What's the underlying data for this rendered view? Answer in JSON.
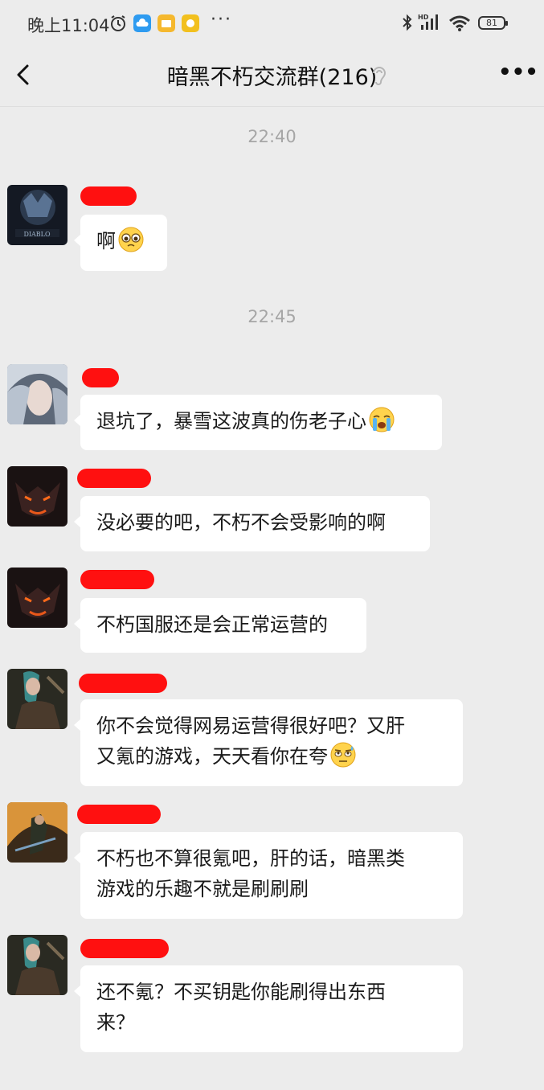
{
  "status_bar": {
    "time": "晚上11:04",
    "battery": "81",
    "more_icons": "···"
  },
  "header": {
    "back_icon": "chevron-left-icon",
    "title": "暗黑不朽交流群(216)",
    "more_label": "•••",
    "mute_icon": "ear-off-icon"
  },
  "chat": {
    "timestamps": [
      "22:40",
      "22:45"
    ],
    "messages": [
      {
        "text": "啊",
        "emoji": "pleading-face"
      },
      {
        "text": "退坑了，暴雪这波真的伤老子心",
        "emoji": "loudly-crying-face"
      },
      {
        "text": "没必要的吧，不朽不会受影响的啊"
      },
      {
        "text": "不朽国服还是会正常运营的"
      },
      {
        "line1": "你不会觉得网易运营得很好吧？又肝",
        "line2": "又氪的游戏，天天看你在夸",
        "emoji": "face-with-rolling-eyes-sweat"
      },
      {
        "line1": "不朽也不算很氪吧，肝的话，暗黑类",
        "line2": "游戏的乐趣不就是刷刷刷"
      },
      {
        "line1": "还不氪？不买钥匙你能刷得出东西",
        "line2": "来？"
      }
    ]
  },
  "colors": {
    "background": "#ececec",
    "bubble": "#ffffff",
    "name_redaction": "#ff1010",
    "timestamp": "#a6a6a6"
  }
}
